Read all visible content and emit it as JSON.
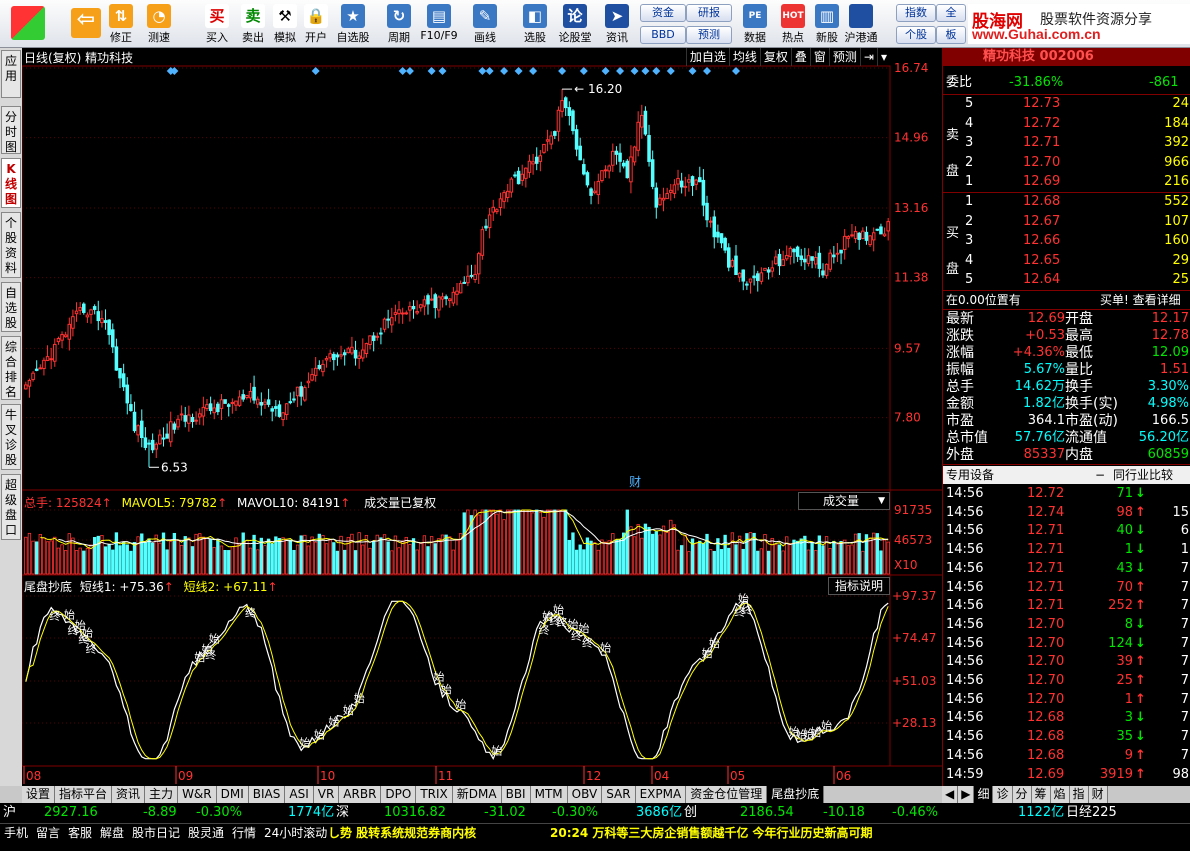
{
  "toolbar": {
    "buttons": [
      {
        "label": "",
        "icon": "windows-logo-icon"
      },
      {
        "label": "",
        "icon": "back-arrow-icon"
      },
      {
        "label": "修正",
        "icon": "updown-arrow-icon"
      },
      {
        "label": "测速",
        "icon": "clock-icon"
      },
      {
        "label": "买入",
        "icon": "buy-icon",
        "glyph": "买"
      },
      {
        "label": "卖出",
        "icon": "sell-icon",
        "glyph": "卖"
      },
      {
        "label": "模拟",
        "icon": "hammer-icon"
      },
      {
        "label": "开户",
        "icon": "lock-icon"
      },
      {
        "label": "自选股",
        "icon": "star-list-icon"
      },
      {
        "label": "周期",
        "icon": "period-icon"
      },
      {
        "label": "F10/F9",
        "icon": "f10-icon"
      },
      {
        "label": "画线",
        "icon": "pencil-icon"
      },
      {
        "label": "选股",
        "icon": "screen-icon"
      },
      {
        "label": "论股堂",
        "icon": "forum-icon",
        "glyph": "论"
      },
      {
        "label": "资讯",
        "icon": "info-icon"
      },
      {
        "label": "数据",
        "icon": "pe-icon",
        "glyph": "PE"
      },
      {
        "label": "热点",
        "icon": "hot-icon",
        "glyph": "HOT"
      },
      {
        "label": "新股",
        "icon": "ipo-icon"
      },
      {
        "label": "沪港通",
        "icon": "sse-hkex-icon"
      }
    ],
    "small_buttons": [
      "资金",
      "研报",
      "BBD",
      "预测",
      "指数",
      "全",
      "个股",
      "板"
    ]
  },
  "brand": {
    "name": "股海网",
    "slogan": "股票软件资源分享",
    "url": "www.Guhai.com.cn"
  },
  "left_tabs": [
    "应用",
    "分时图",
    "K线图",
    "个股资料",
    "自选股",
    "综合排名",
    "牛叉诊股",
    "超级盘口"
  ],
  "chart": {
    "title": "日线(复权)  精功科技",
    "tools": [
      "加自选",
      "均线",
      "复权",
      "叠",
      "窗",
      "预测",
      "⇥",
      "▾"
    ],
    "price_axis": [
      "16.74",
      "14.96",
      "13.16",
      "11.38",
      "9.57",
      "7.80"
    ],
    "high_label": "16.20",
    "low_label": "6.53",
    "cai_marker": "财",
    "volume": {
      "label_total": "总手: 125824",
      "label_ma5": "MAVOL5: 79782",
      "label_ma10": "MAVOL10: 84191",
      "label_note": "成交量已复权",
      "dropdown": "成交量",
      "axis": [
        "91735",
        "46573",
        "X10"
      ]
    },
    "indicator": {
      "name": "尾盘抄底",
      "line1": "短线1: +75.36",
      "line2": "短线2: +67.11",
      "help": "指标说明",
      "axis": [
        "+97.37",
        "+74.47",
        "+51.03",
        "+28.13"
      ],
      "marker_buy": "始",
      "marker_sell": "终"
    },
    "months": [
      "08",
      "09",
      "10",
      "11",
      "12",
      "04",
      "05",
      "06"
    ]
  },
  "chart_data": {
    "type": "candlestick",
    "title": "日线(复权) 精功科技",
    "ylim": [
      6.0,
      16.74
    ],
    "high": 16.2,
    "low": 6.53,
    "months": [
      "08",
      "09",
      "10",
      "11",
      "12",
      "04",
      "05",
      "06"
    ]
  },
  "quote": {
    "name_partial": "精功科技 002006",
    "weibi_label": "委比",
    "weibi_value": "-31.86%",
    "weibi_diff": "-861",
    "sell_label": "卖盘",
    "buy_label": "买盘",
    "sells": [
      {
        "level": "5",
        "price": "12.73",
        "vol": "24"
      },
      {
        "level": "4",
        "price": "12.72",
        "vol": "184"
      },
      {
        "level": "3",
        "price": "12.71",
        "vol": "392"
      },
      {
        "level": "2",
        "price": "12.70",
        "vol": "966"
      },
      {
        "level": "1",
        "price": "12.69",
        "vol": "216"
      }
    ],
    "buys": [
      {
        "level": "1",
        "price": "12.68",
        "vol": "552"
      },
      {
        "level": "2",
        "price": "12.67",
        "vol": "107"
      },
      {
        "level": "3",
        "price": "12.66",
        "vol": "160"
      },
      {
        "level": "4",
        "price": "12.65",
        "vol": "29"
      },
      {
        "level": "5",
        "price": "12.64",
        "vol": "25"
      }
    ],
    "position_text": "在0.00位置有",
    "detail_text": "买单! 查看详细",
    "stats": [
      [
        "最新",
        "12.69",
        "开盘",
        "12.17"
      ],
      [
        "涨跌",
        "+0.53",
        "最高",
        "12.78"
      ],
      [
        "涨幅",
        "+4.36%",
        "最低",
        "12.09"
      ],
      [
        "振幅",
        "5.67%",
        "量比",
        "1.51"
      ],
      [
        "总手",
        "14.62万",
        "换手",
        "3.30%"
      ],
      [
        "金额",
        "1.82亿",
        "换手(实)",
        "4.98%"
      ],
      [
        "市盈",
        "364.1",
        "市盈(动)",
        "166.5"
      ],
      [
        "总市值",
        "57.76亿",
        "流通值",
        "56.20亿"
      ],
      [
        "外盘",
        "85337",
        "内盘",
        "60859"
      ]
    ],
    "tab_left": "专用设备",
    "tab_right": "同行业比较"
  },
  "ticks": [
    {
      "time": "14:56",
      "price": "12.72",
      "vol": "71",
      "dir": "down",
      "extra": ""
    },
    {
      "time": "14:56",
      "price": "12.74",
      "vol": "98",
      "dir": "up",
      "extra": "15"
    },
    {
      "time": "14:56",
      "price": "12.71",
      "vol": "40",
      "dir": "down",
      "extra": "6"
    },
    {
      "time": "14:56",
      "price": "12.71",
      "vol": "1",
      "dir": "down",
      "extra": "1"
    },
    {
      "time": "14:56",
      "price": "12.71",
      "vol": "43",
      "dir": "down",
      "extra": "7"
    },
    {
      "time": "14:56",
      "price": "12.71",
      "vol": "70",
      "dir": "up",
      "extra": "7"
    },
    {
      "time": "14:56",
      "price": "12.71",
      "vol": "252",
      "dir": "up",
      "extra": "7"
    },
    {
      "time": "14:56",
      "price": "12.70",
      "vol": "8",
      "dir": "down",
      "extra": "7"
    },
    {
      "time": "14:56",
      "price": "12.70",
      "vol": "124",
      "dir": "down",
      "extra": "7"
    },
    {
      "time": "14:56",
      "price": "12.70",
      "vol": "39",
      "dir": "up",
      "extra": "7"
    },
    {
      "time": "14:56",
      "price": "12.70",
      "vol": "25",
      "dir": "up",
      "extra": "7"
    },
    {
      "time": "14:56",
      "price": "12.70",
      "vol": "1",
      "dir": "up",
      "extra": "7"
    },
    {
      "time": "14:56",
      "price": "12.68",
      "vol": "3",
      "dir": "down",
      "extra": "7"
    },
    {
      "time": "14:56",
      "price": "12.68",
      "vol": "35",
      "dir": "down",
      "extra": "7"
    },
    {
      "time": "14:56",
      "price": "12.68",
      "vol": "9",
      "dir": "up",
      "extra": "7"
    },
    {
      "time": "14:59",
      "price": "12.69",
      "vol": "3919",
      "dir": "up",
      "extra": "98"
    }
  ],
  "bottom_tabs": [
    "设置",
    "指标平台",
    "资讯",
    "主力",
    "W&R",
    "DMI",
    "BIAS",
    "ASI",
    "VR",
    "ARBR",
    "DPO",
    "TRIX",
    "新DMA",
    "BBI",
    "MTM",
    "OBV",
    "SAR",
    "EXPMA",
    "资金仓位管理",
    "尾盘抄底"
  ],
  "right_tabs": [
    "◀",
    "▶",
    "细",
    "诊",
    "分",
    "筹",
    "焰",
    "指",
    "财"
  ],
  "index_bar": {
    "sh_label": "沪",
    "sh_value": "2927.16",
    "sh_change": "-8.89",
    "sh_pct": "-0.30%",
    "sh_amount": "1774亿",
    "sz_label": "深",
    "sz_value": "10316.82",
    "sz_change": "-31.02",
    "sz_pct": "-0.30%",
    "sz_amount": "3686亿",
    "cy_label": "创",
    "cy_value": "2186.54",
    "cy_change": "-10.18",
    "cy_pct": "-0.46%",
    "cy_amount": "1122亿",
    "extra": "日经225"
  },
  "status_bar": {
    "items": [
      "手机",
      "留言",
      "客服",
      "解盘",
      "股市日记",
      "股灵通",
      "行情",
      "24小时滚动"
    ],
    "news1": "し势 股转系统规范券商内核",
    "news2": "20:24 万科等三大房企销售额越千亿 今年行业历史新高可期"
  },
  "colors": {
    "up": "#ff3232",
    "down": "#54ffff",
    "ma": "#ffffff",
    "grid": "#550000"
  }
}
